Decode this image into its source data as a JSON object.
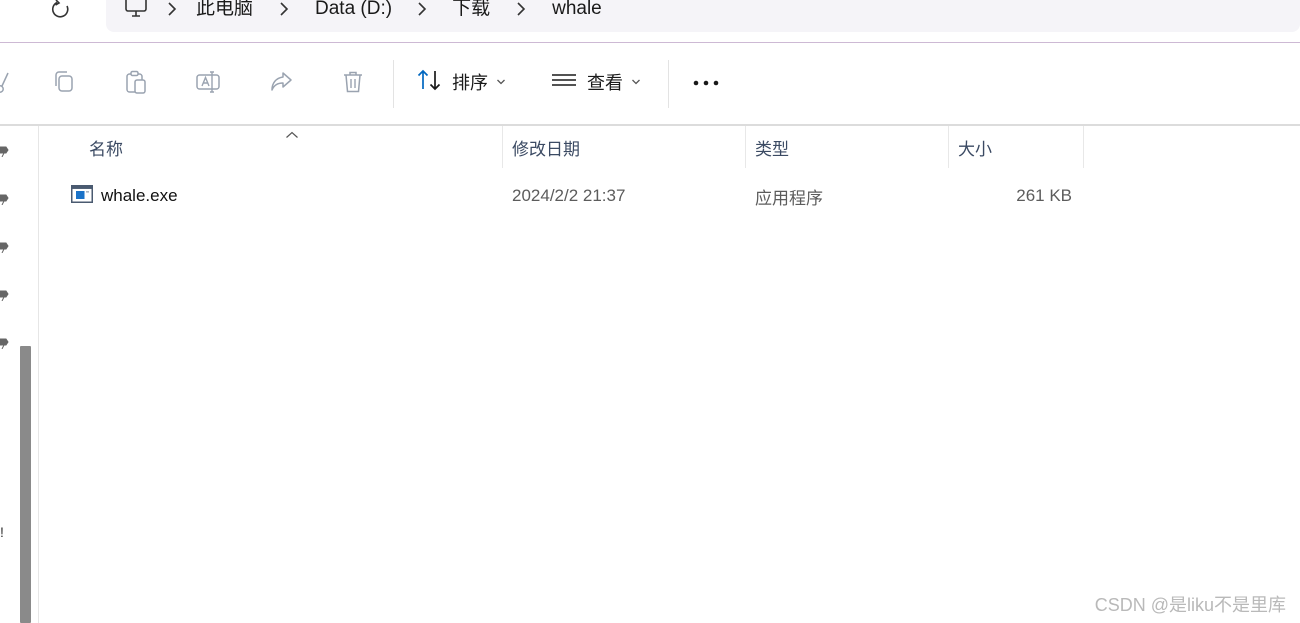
{
  "address_bar": {
    "breadcrumbs": [
      "此电脑",
      "Data (D:)",
      "下载",
      "whale"
    ]
  },
  "toolbar": {
    "sort_label": "排序",
    "view_label": "查看"
  },
  "file_list": {
    "columns": [
      "名称",
      "修改日期",
      "类型",
      "大小"
    ],
    "rows": [
      {
        "name": "whale.exe",
        "modified": "2024/2/2 21:37",
        "type": "应用程序",
        "size": "261 KB"
      }
    ]
  },
  "left_edge_glyph": "!",
  "watermark": "CSDN @是liku不是里库",
  "colors": {
    "accent": "#0067c0",
    "icon_gray": "#9aa3b0",
    "header_text": "#3b4a63"
  }
}
